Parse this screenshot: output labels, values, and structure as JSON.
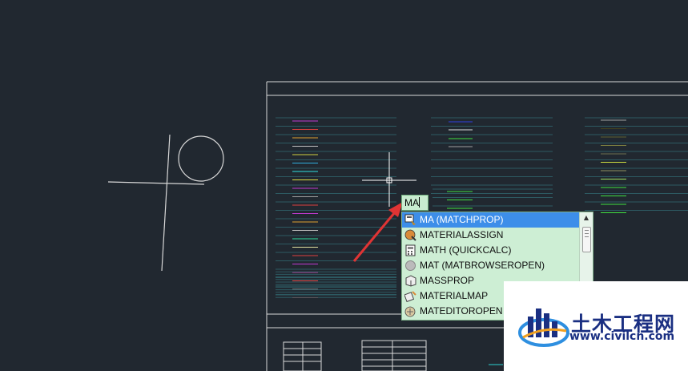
{
  "command_line": {
    "input_value": "MA"
  },
  "autocomplete": {
    "items": [
      {
        "label": "MA (MATCHPROP)",
        "icon": "matchprop-icon",
        "selected": true
      },
      {
        "label": "MATERIALASSIGN",
        "icon": "material-assign-icon",
        "selected": false
      },
      {
        "label": "MATH (QUICKCALC)",
        "icon": "calculator-icon",
        "selected": false
      },
      {
        "label": "MAT (MATBROWSEROPEN)",
        "icon": "material-browser-icon",
        "selected": false
      },
      {
        "label": "MASSPROP",
        "icon": "massprop-icon",
        "selected": false
      },
      {
        "label": "MATERIALMAP",
        "icon": "material-map-icon",
        "selected": false
      },
      {
        "label": "MATEDITOROPEN",
        "icon": "material-editor-icon",
        "selected": false
      }
    ]
  },
  "watermark": {
    "title": "土木工程网",
    "url": "www.civilcn.com"
  },
  "colors": {
    "background": "#212830",
    "line": "#d8d8d8",
    "arrow": "#e03434",
    "selection": "#3d8ee9",
    "dropdown": "#cdeed4",
    "brand": "#1a2f82"
  }
}
